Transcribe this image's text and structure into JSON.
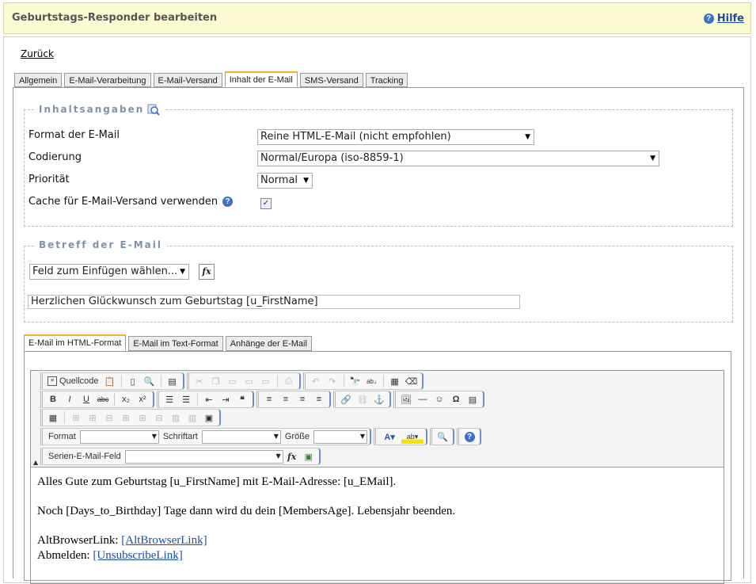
{
  "header": {
    "title": "Geburtstags-Responder bearbeiten",
    "help_label": "Hilfe"
  },
  "nav": {
    "back_label": "Zurück"
  },
  "tabs": [
    {
      "label": "Allgemein"
    },
    {
      "label": "E-Mail-Verarbeitung"
    },
    {
      "label": "E-Mail-Versand"
    },
    {
      "label": "Inhalt der E-Mail"
    },
    {
      "label": "SMS-Versand"
    },
    {
      "label": "Tracking"
    }
  ],
  "inhalt": {
    "legend": "Inhaltsangaben",
    "format_label": "Format der E-Mail",
    "format_value": "Reine HTML-E-Mail (nicht empfohlen)",
    "codierung_label": "Codierung",
    "codierung_value": "Normal/Europa (iso-8859-1)",
    "prioritaet_label": "Priorität",
    "prioritaet_value": "Normal",
    "cache_label": "Cache für E-Mail-Versand verwenden",
    "cache_checked": true
  },
  "betreff": {
    "legend": "Betreff der E-Mail",
    "field_select": "Feld zum Einfügen wählen...",
    "fx_label": "fx",
    "subject_value": "Herzlichen Glückwunsch zum Geburtstag [u_FirstName]"
  },
  "subtabs": [
    {
      "label": "E-Mail im HTML-Format"
    },
    {
      "label": "E-Mail im Text-Format"
    },
    {
      "label": "Anhänge der E-Mail"
    }
  ],
  "toolbar": {
    "source_label": "Quellcode",
    "format_label": "Format",
    "font_label": "Schriftart",
    "size_label": "Größe",
    "mergefield_label": "Serien-E-Mail-Feld",
    "bold": "B",
    "italic": "I",
    "underline": "U",
    "strike": "abc",
    "sub": "x₂",
    "sup": "x²",
    "omega": "Ω",
    "fx": "fx"
  },
  "body": {
    "line1": "Alles Gute zum Geburtstag [u_FirstName] mit E-Mail-Adresse: [u_EMail].",
    "line2": "Noch [Days_to_Birthday] Tage dann wird du dein [MembersAge]. Lebensjahr beenden.",
    "alt_label": "AltBrowserLink: ",
    "alt_link": "[AltBrowserLink]",
    "unsub_label": "Abmelden: ",
    "unsub_link": "[UnsubscribeLink]"
  },
  "colors": {
    "header_bg": "#fcfbd3",
    "active_tab_accent": "#f3b132",
    "legend_text": "#8091a8",
    "link": "#1d4fa0"
  }
}
